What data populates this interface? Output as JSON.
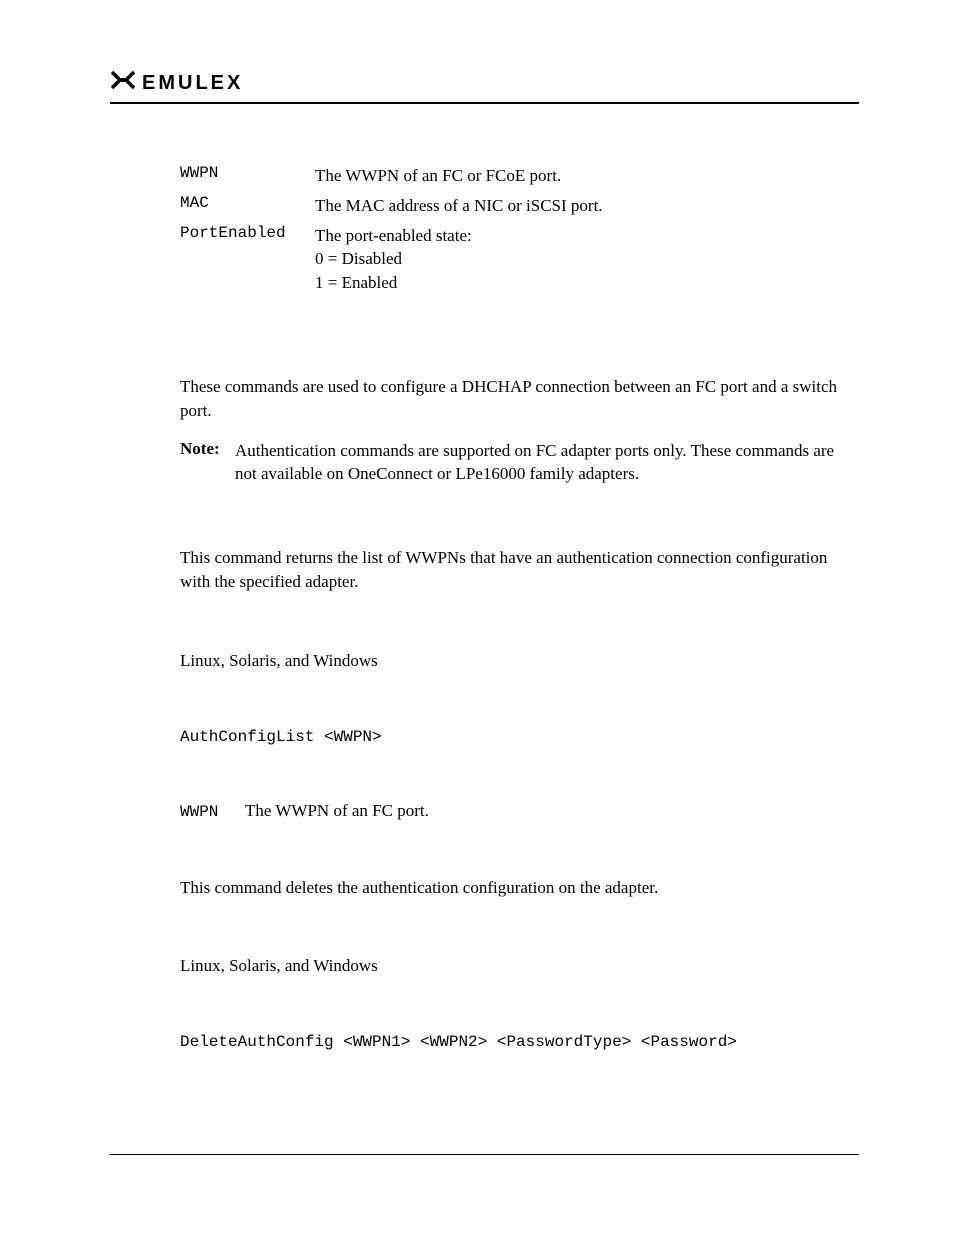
{
  "logo": {
    "text": "EMULEX"
  },
  "params_top": [
    {
      "name": "WWPN",
      "desc": "The WWPN of an FC or FCoE port."
    },
    {
      "name": "MAC",
      "desc": "The MAC address of a NIC or iSCSI port."
    },
    {
      "name": "PortEnabled",
      "desc": "The port-enabled state:\n0 = Disabled\n1 = Enabled"
    }
  ],
  "intro_dhchap": "These commands are used to configure a DHCHAP connection between an FC port and a switch port.",
  "note": {
    "label": "Note:",
    "text": "Authentication commands are supported on FC adapter ports only. These commands are not available on OneConnect or LPe16000 family adapters."
  },
  "authconfiglist": {
    "desc": "This command returns the list of WWPNs that have an authentication connection configuration with the specified adapter.",
    "os": "Linux, Solaris, and Windows",
    "syntax": "AuthConfigList <WWPN>",
    "param_name": "WWPN",
    "param_desc": "The WWPN of an FC port."
  },
  "deleteauthconfig": {
    "desc": "This command deletes the authentication configuration on the adapter.",
    "os": "Linux, Solaris, and Windows",
    "syntax": "DeleteAuthConfig <WWPN1> <WWPN2> <PasswordType> <Password>"
  }
}
